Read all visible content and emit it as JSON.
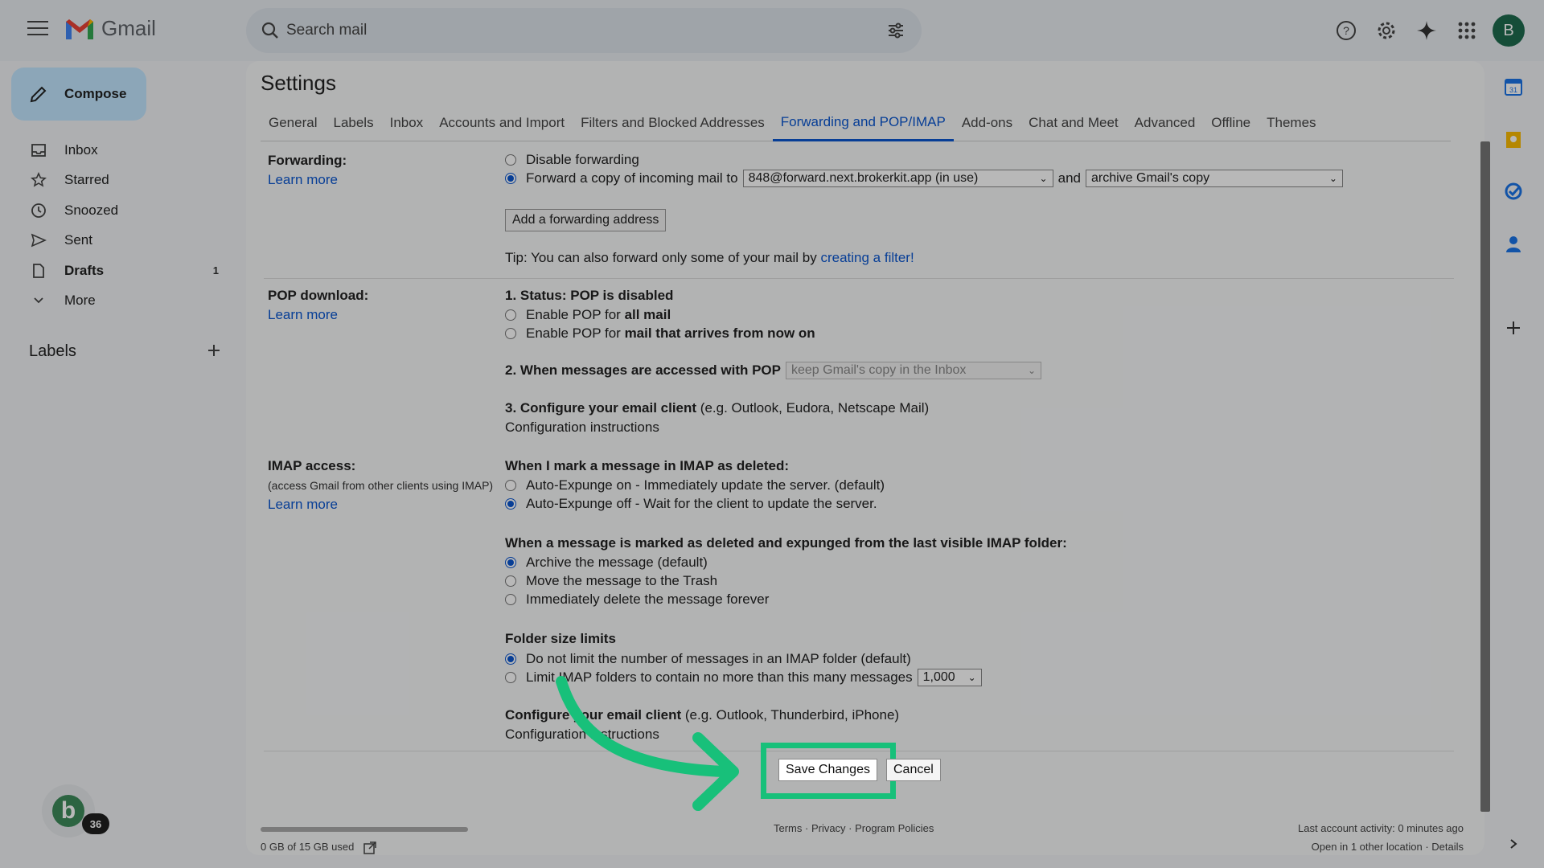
{
  "app": {
    "name": "Gmail"
  },
  "search": {
    "placeholder": "Search mail"
  },
  "topbar": {
    "avatar_letter": "B"
  },
  "compose": {
    "label": "Compose"
  },
  "nav": {
    "items": [
      {
        "label": "Inbox",
        "icon": "inbox-icon"
      },
      {
        "label": "Starred",
        "icon": "star-icon"
      },
      {
        "label": "Snoozed",
        "icon": "clock-icon"
      },
      {
        "label": "Sent",
        "icon": "send-icon"
      },
      {
        "label": "Drafts",
        "icon": "draft-icon",
        "count": "1"
      },
      {
        "label": "More",
        "icon": "chevron-down-icon"
      }
    ],
    "labels_heading": "Labels"
  },
  "chat": {
    "avatar_letter": "b",
    "badge": "36"
  },
  "settings": {
    "title": "Settings",
    "tabs": [
      "General",
      "Labels",
      "Inbox",
      "Accounts and Import",
      "Filters and Blocked Addresses",
      "Forwarding and POP/IMAP",
      "Add-ons",
      "Chat and Meet",
      "Advanced",
      "Offline",
      "Themes"
    ],
    "active_tab": "Forwarding and POP/IMAP"
  },
  "forwarding": {
    "label": "Forwarding:",
    "learn_more": "Learn more",
    "disable": "Disable forwarding",
    "forward_prefix": "Forward a copy of incoming mail to",
    "address": "848@forward.next.brokerkit.app (in use)",
    "and": "and",
    "action": "archive Gmail's copy",
    "add_button": "Add a forwarding address",
    "tip_prefix": "Tip: You can also forward only some of your mail by",
    "tip_link": "creating a filter!"
  },
  "pop": {
    "label": "POP download:",
    "learn_more": "Learn more",
    "status": "1. Status: POP is disabled",
    "enable_all_prefix": "Enable POP for",
    "enable_all_bold": "all mail",
    "enable_now_prefix": "Enable POP for",
    "enable_now_bold": "mail that arrives from now on",
    "accessed_label": "2. When messages are accessed with POP",
    "accessed_value": "keep Gmail's copy in the Inbox",
    "configure_bold": "3. Configure your email client",
    "configure_rest": "(e.g. Outlook, Eudora, Netscape Mail)",
    "config_link": "Configuration instructions"
  },
  "imap": {
    "label": "IMAP access:",
    "sub": "(access Gmail from other clients using IMAP)",
    "learn_more": "Learn more",
    "deleted_heading": "When I mark a message in IMAP as deleted:",
    "expunge_on": "Auto-Expunge on - Immediately update the server. (default)",
    "expunge_off": "Auto-Expunge off - Wait for the client to update the server.",
    "expunged_heading": "When a message is marked as deleted and expunged from the last visible IMAP folder:",
    "archive": "Archive the message (default)",
    "trash": "Move the message to the Trash",
    "delete_forever": "Immediately delete the message forever",
    "folder_heading": "Folder size limits",
    "no_limit": "Do not limit the number of messages in an IMAP folder (default)",
    "limit": "Limit IMAP folders to contain no more than this many messages",
    "limit_value": "1,000",
    "configure_bold": "Configure your email client",
    "configure_rest": "(e.g. Outlook, Thunderbird, iPhone)",
    "config_link": "Configuration instructions"
  },
  "actions": {
    "save": "Save Changes",
    "cancel": "Cancel"
  },
  "footer": {
    "storage": "0 GB of 15 GB used",
    "links": "Terms · Privacy · Program Policies",
    "activity": "Last account activity: 0 minutes ago",
    "location": "Open in 1 other location · Details"
  },
  "colors": {
    "accent": "#0b57d0",
    "highlight": "#18c07a",
    "compose": "#c2e7ff"
  }
}
